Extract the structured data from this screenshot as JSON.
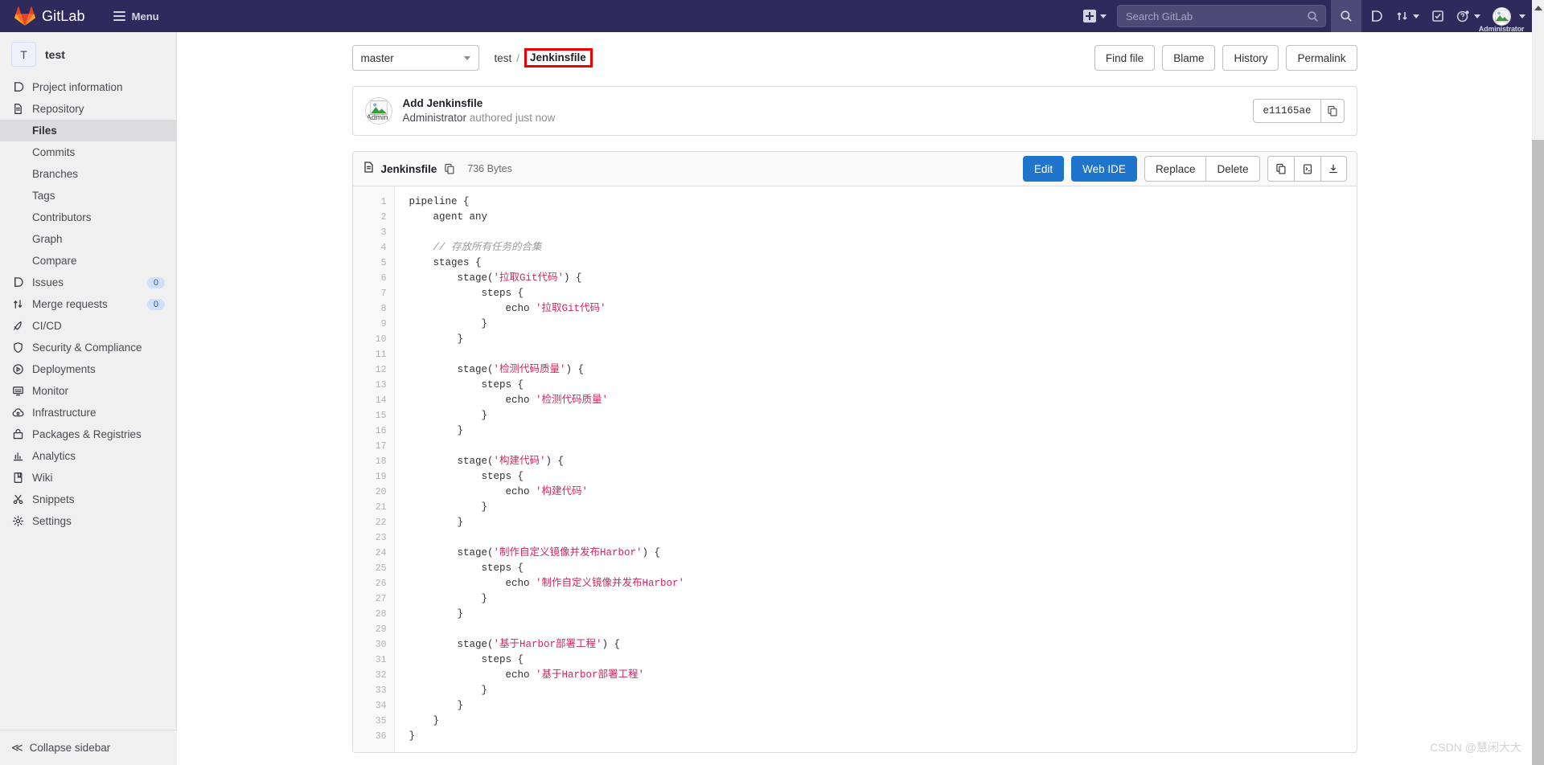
{
  "navbar": {
    "brand": "GitLab",
    "menu_label": "Menu",
    "new_icon": "plus-square-icon",
    "search_placeholder": "Search GitLab",
    "icons": [
      "search-icon",
      "issues-icon",
      "merge-requests-icon",
      "todos-icon",
      "help-icon"
    ],
    "user_name": "Administrator"
  },
  "sidebar": {
    "project_initial": "T",
    "project_name": "test",
    "items": [
      {
        "label": "Project information",
        "icon": "doc-information-icon",
        "active": false,
        "sub": false
      },
      {
        "label": "Repository",
        "icon": "repository-icon",
        "active": false,
        "sub": false
      },
      {
        "label": "Files",
        "icon": "",
        "active": true,
        "sub": true
      },
      {
        "label": "Commits",
        "icon": "",
        "active": false,
        "sub": true
      },
      {
        "label": "Branches",
        "icon": "",
        "active": false,
        "sub": true
      },
      {
        "label": "Tags",
        "icon": "",
        "active": false,
        "sub": true
      },
      {
        "label": "Contributors",
        "icon": "",
        "active": false,
        "sub": true
      },
      {
        "label": "Graph",
        "icon": "",
        "active": false,
        "sub": true
      },
      {
        "label": "Compare",
        "icon": "",
        "active": false,
        "sub": true
      },
      {
        "label": "Issues",
        "icon": "issues-icon",
        "active": false,
        "sub": false,
        "badge": "0"
      },
      {
        "label": "Merge requests",
        "icon": "merge-requests-icon",
        "active": false,
        "sub": false,
        "badge": "0"
      },
      {
        "label": "CI/CD",
        "icon": "rocket-icon",
        "active": false,
        "sub": false
      },
      {
        "label": "Security & Compliance",
        "icon": "shield-icon",
        "active": false,
        "sub": false
      },
      {
        "label": "Deployments",
        "icon": "deployments-icon",
        "active": false,
        "sub": false
      },
      {
        "label": "Monitor",
        "icon": "monitor-icon",
        "active": false,
        "sub": false
      },
      {
        "label": "Infrastructure",
        "icon": "cloud-icon",
        "active": false,
        "sub": false
      },
      {
        "label": "Packages & Registries",
        "icon": "package-icon",
        "active": false,
        "sub": false
      },
      {
        "label": "Analytics",
        "icon": "chart-icon",
        "active": false,
        "sub": false
      },
      {
        "label": "Wiki",
        "icon": "book-icon",
        "active": false,
        "sub": false
      },
      {
        "label": "Snippets",
        "icon": "scissors-icon",
        "active": false,
        "sub": false
      },
      {
        "label": "Settings",
        "icon": "gear-icon",
        "active": false,
        "sub": false
      }
    ],
    "collapse_label": "Collapse sidebar",
    "collapse_icon": "double-chevron-left-icon"
  },
  "toolbar": {
    "branch": "master",
    "breadcrumb_root": "test",
    "breadcrumb_sep": "/",
    "breadcrumb_current": "Jenkinsfile",
    "highlight_color": "#ef0000",
    "buttons": [
      "Find file",
      "Blame",
      "History",
      "Permalink"
    ]
  },
  "commit": {
    "message": "Add Jenkinsfile",
    "author": "Administrator",
    "authored_text": "authored just now",
    "sha": "e11165ae",
    "copy_icon": "copy-icon",
    "avatar_alt": "Admin"
  },
  "file": {
    "icon": "file-icon",
    "name": "Jenkinsfile",
    "copy_path_icon": "copy-icon",
    "size": "736 Bytes",
    "actions": [
      "Edit",
      "Web IDE",
      "Replace",
      "Delete"
    ],
    "icon_actions": [
      "copy-contents-icon",
      "open-raw-icon",
      "download-icon"
    ]
  },
  "code": {
    "line_numbers": [
      1,
      2,
      3,
      4,
      5,
      6,
      7,
      8,
      9,
      10,
      11,
      12,
      13,
      14,
      15,
      16,
      17,
      18,
      19,
      20,
      21,
      22,
      23,
      24,
      25,
      26,
      27,
      28,
      29,
      30,
      31,
      32,
      33,
      34,
      35,
      36
    ],
    "lines": [
      "pipeline {",
      "    agent any",
      "",
      "    // 存放所有任务的合集",
      "    stages {",
      "        stage('拉取Git代码') {",
      "            steps {",
      "                echo '拉取Git代码'",
      "            }",
      "        }",
      "",
      "        stage('检测代码质量') {",
      "            steps {",
      "                echo '检测代码质量'",
      "            }",
      "        }",
      "",
      "        stage('构建代码') {",
      "            steps {",
      "                echo '构建代码'",
      "            }",
      "        }",
      "",
      "        stage('制作自定义镜像并发布Harbor') {",
      "            steps {",
      "                echo '制作自定义镜像并发布Harbor'",
      "            }",
      "        }",
      "",
      "        stage('基于Harbor部署工程') {",
      "            steps {",
      "                echo '基于Harbor部署工程'",
      "            }",
      "        }",
      "    }",
      "}"
    ]
  },
  "watermark": "CSDN @慧闲大大"
}
